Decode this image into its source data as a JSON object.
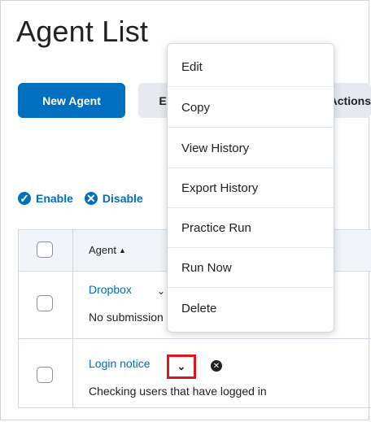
{
  "page": {
    "title": "Agent List"
  },
  "toolbar": {
    "new_agent": "New Agent",
    "second_button_visible": "E",
    "third_button_visible": "Actions"
  },
  "bulk": {
    "enable": "Enable",
    "disable": "Disable"
  },
  "table": {
    "header_agent": "Agent",
    "rows": [
      {
        "name": "Dropbox",
        "desc": "No submission"
      },
      {
        "name": "Login notice",
        "desc": "Checking users that have logged in"
      }
    ]
  },
  "menu": {
    "items": [
      "Edit",
      "Copy",
      "View History",
      "Export History",
      "Practice Run",
      "Run Now",
      "Delete"
    ]
  },
  "icons": {
    "check": "check-circle-icon",
    "close": "close-circle-icon",
    "chevron": "chevron-down-icon",
    "sort": "sort-ascending-icon"
  },
  "colors": {
    "accent": "#006fbf",
    "highlight": "#e0141e"
  }
}
